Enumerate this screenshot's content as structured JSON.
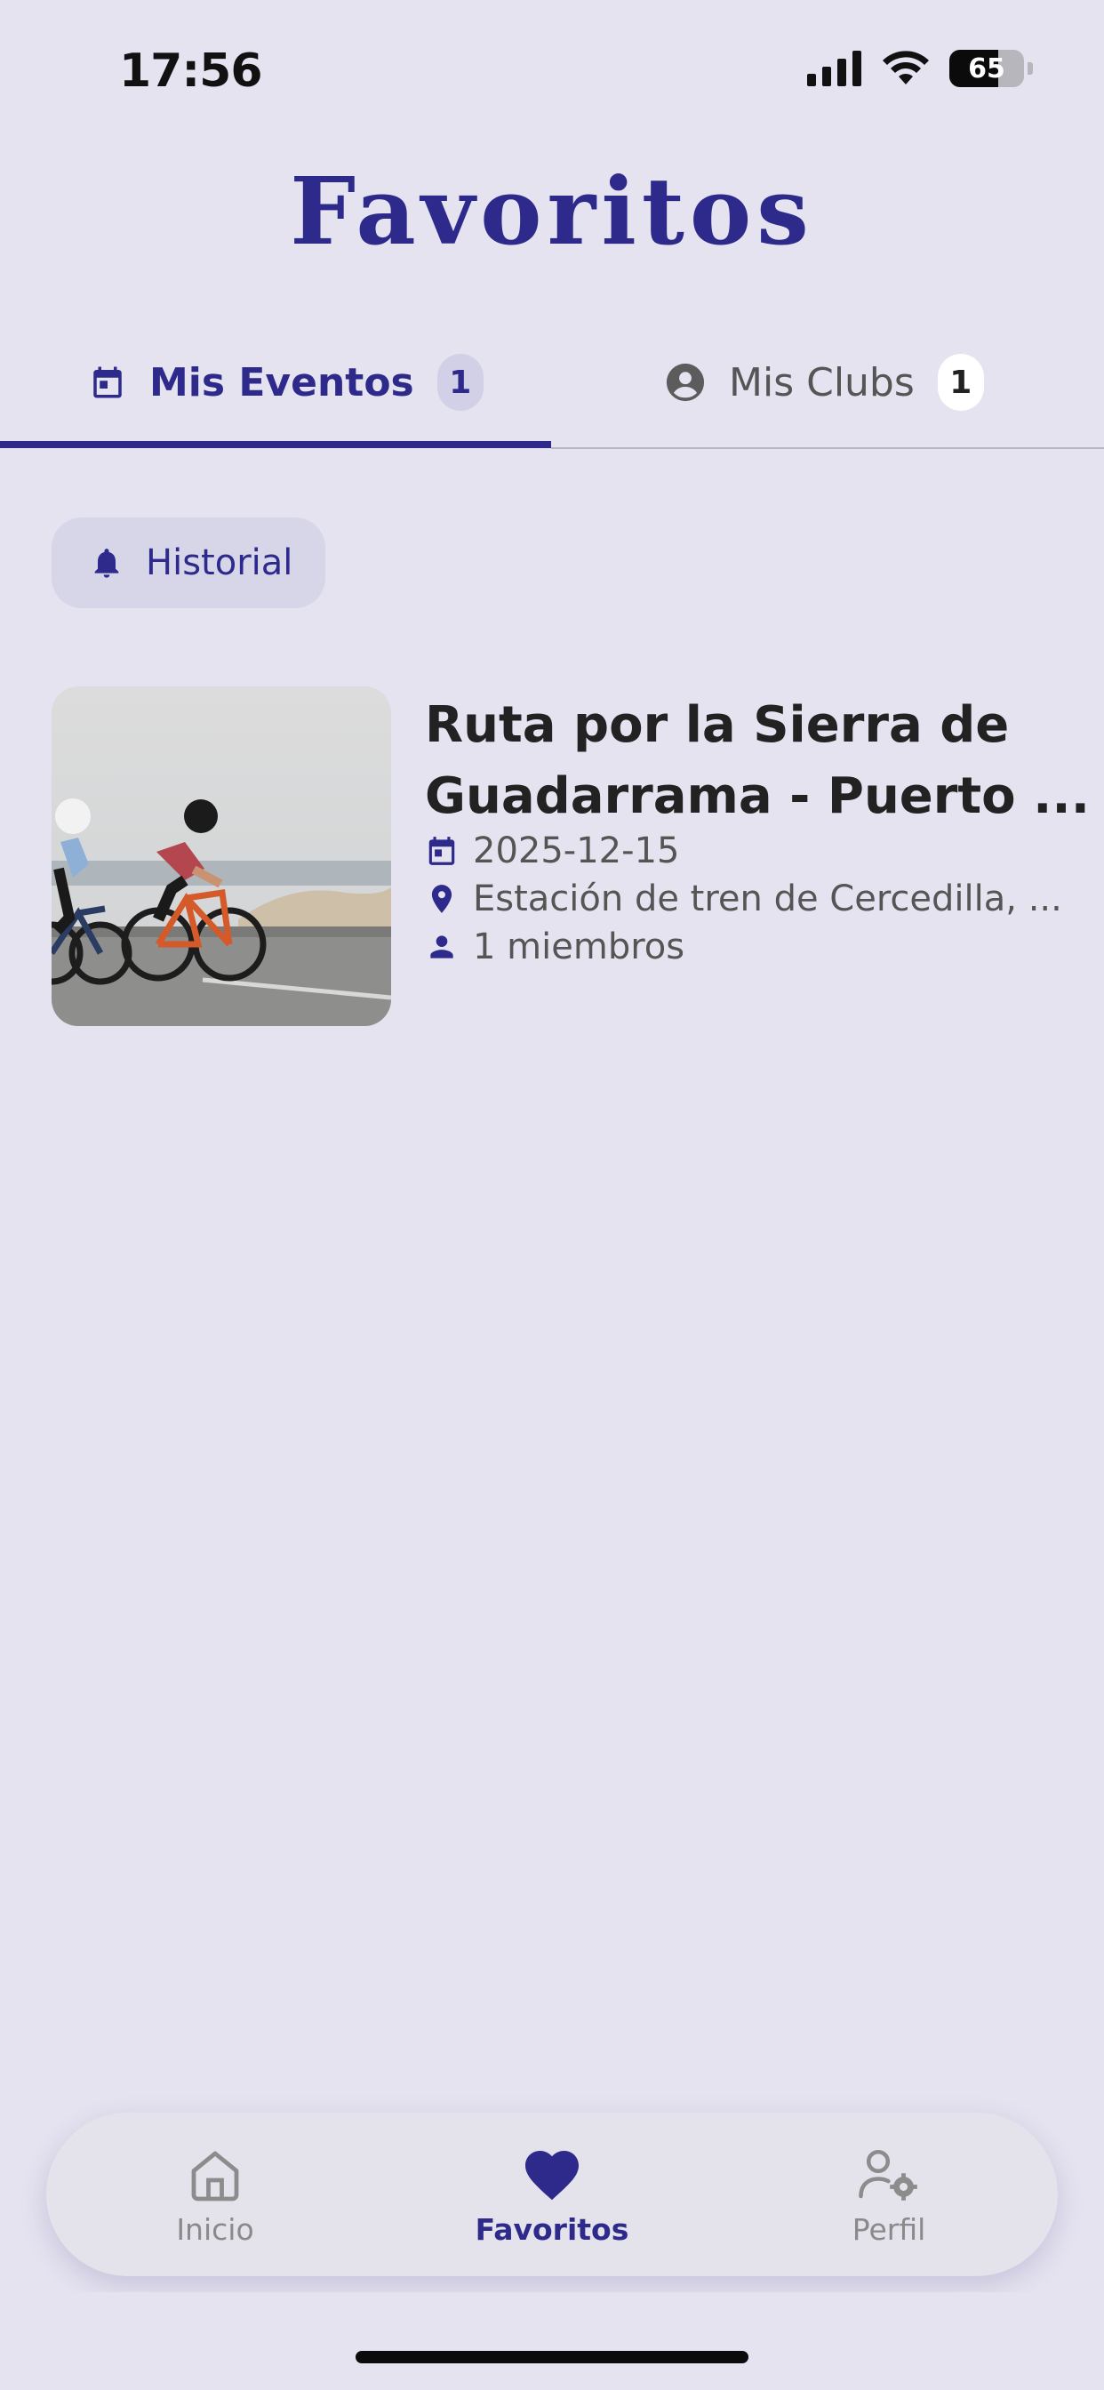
{
  "status_bar": {
    "time": "17:56",
    "battery_level": "65",
    "battery_percent": 65,
    "icons": [
      "signal-icon",
      "wifi-icon",
      "battery-icon"
    ]
  },
  "page": {
    "title": "Favoritos"
  },
  "tabs": [
    {
      "label": "Mis Eventos",
      "count": "1",
      "icon": "calendar-icon",
      "active": true
    },
    {
      "label": "Mis Clubs",
      "count": "1",
      "icon": "account-circle-icon",
      "active": false
    }
  ],
  "history_button": {
    "label": "Historial",
    "icon": "bell-icon"
  },
  "events": [
    {
      "title_line1": "Ruta por la Sierra de",
      "title_line2": "Guadarrama - Puerto ...",
      "date": "2025-12-15",
      "location": "Estación de tren de Cercedilla, ...",
      "members": "1 miembros",
      "image": "cyclists-on-road-photo"
    }
  ],
  "bottom_nav": [
    {
      "label": "Inicio",
      "icon": "home-icon",
      "active": false
    },
    {
      "label": "Favoritos",
      "icon": "heart-icon",
      "active": true
    },
    {
      "label": "Perfil",
      "icon": "user-settings-icon",
      "active": false
    }
  ],
  "colors": {
    "background": "#e5e3f0",
    "accent": "#2d2a8c",
    "chip": "#d7d5e8",
    "muted_text": "#555555"
  }
}
